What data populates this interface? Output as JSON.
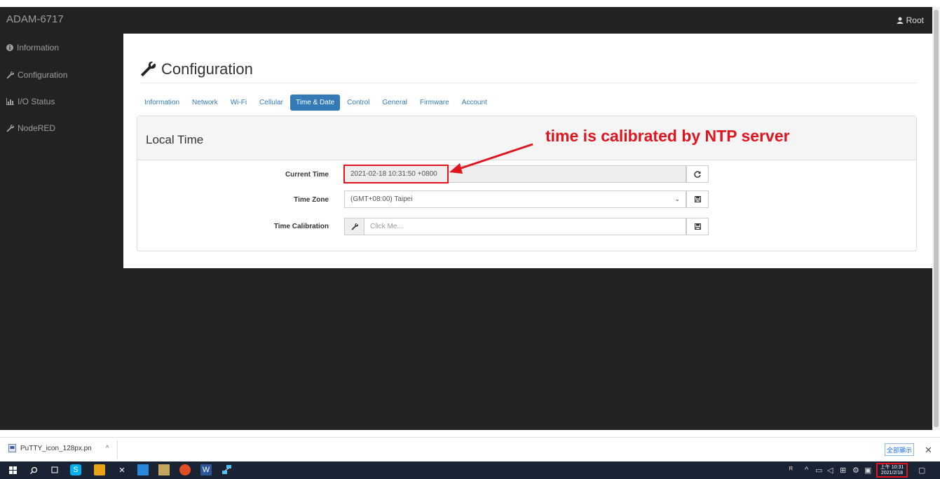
{
  "topbar": {
    "brand": "ADAM-6717",
    "user": "Root"
  },
  "sidebar": {
    "items": [
      {
        "label": "Information",
        "icon": "info-circle-icon"
      },
      {
        "label": "Configuration",
        "icon": "wrench-icon"
      },
      {
        "label": "I/O Status",
        "icon": "bar-chart-icon"
      },
      {
        "label": "NodeRED",
        "icon": "wrench-icon"
      }
    ]
  },
  "page": {
    "title": "Configuration",
    "icon": "wrench-icon"
  },
  "tabs": [
    {
      "label": "Information",
      "active": false
    },
    {
      "label": "Network",
      "active": false
    },
    {
      "label": "Wi-Fi",
      "active": false
    },
    {
      "label": "Cellular",
      "active": false
    },
    {
      "label": "Time & Date",
      "active": true
    },
    {
      "label": "Control",
      "active": false
    },
    {
      "label": "General",
      "active": false
    },
    {
      "label": "Firmware",
      "active": false
    },
    {
      "label": "Account",
      "active": false
    }
  ],
  "panel": {
    "title": "Local Time",
    "current_time": {
      "label": "Current Time",
      "value": "2021-02-18 10:31:50 +0800"
    },
    "time_zone": {
      "label": "Time Zone",
      "value": "(GMT+08:00) Taipei"
    },
    "time_calibration": {
      "label": "Time Calibration",
      "placeholder": "Click Me..."
    }
  },
  "annotation": {
    "text": "time is calibrated by NTP server",
    "color": "#e0141e"
  },
  "download_bar": {
    "filename": "PuTTY_icon_128px.pn",
    "show_all": "全部顯示"
  },
  "taskbar": {
    "clock_time": "上午 10:31",
    "clock_date": "2021/2/18"
  },
  "colors": {
    "accent": "#337ab7",
    "dark": "#222222",
    "annotation": "#e0141e"
  }
}
